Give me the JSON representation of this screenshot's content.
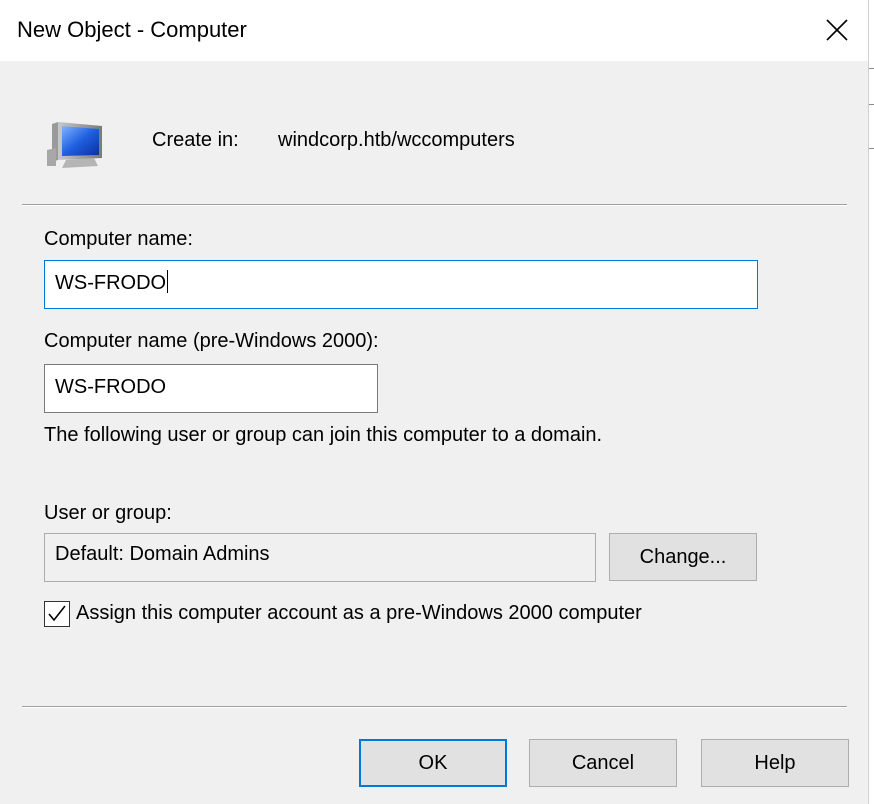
{
  "window": {
    "title": "New Object - Computer",
    "close_icon": "close-icon"
  },
  "header": {
    "icon": "computer-icon",
    "create_in_label": "Create in:",
    "create_in_value": "windcorp.htb/wccomputers"
  },
  "form": {
    "computer_name_label": "Computer name:",
    "computer_name_value": "WS-FRODO",
    "pre2000_label": "Computer name (pre-Windows 2000):",
    "pre2000_value": "WS-FRODO",
    "join_info": "The following user or group can join this computer to a domain.",
    "user_group_label": "User or group:",
    "user_group_value": "Default: Domain Admins",
    "change_button": "Change...",
    "assign_checkbox_label": "Assign this computer account as a pre-Windows 2000 computer",
    "assign_checked": true
  },
  "buttons": {
    "ok": "OK",
    "cancel": "Cancel",
    "help": "Help"
  },
  "colors": {
    "focus_accent": "#0078d7",
    "dialog_bg": "#f0f0f0",
    "button_bg": "#e1e1e1"
  }
}
